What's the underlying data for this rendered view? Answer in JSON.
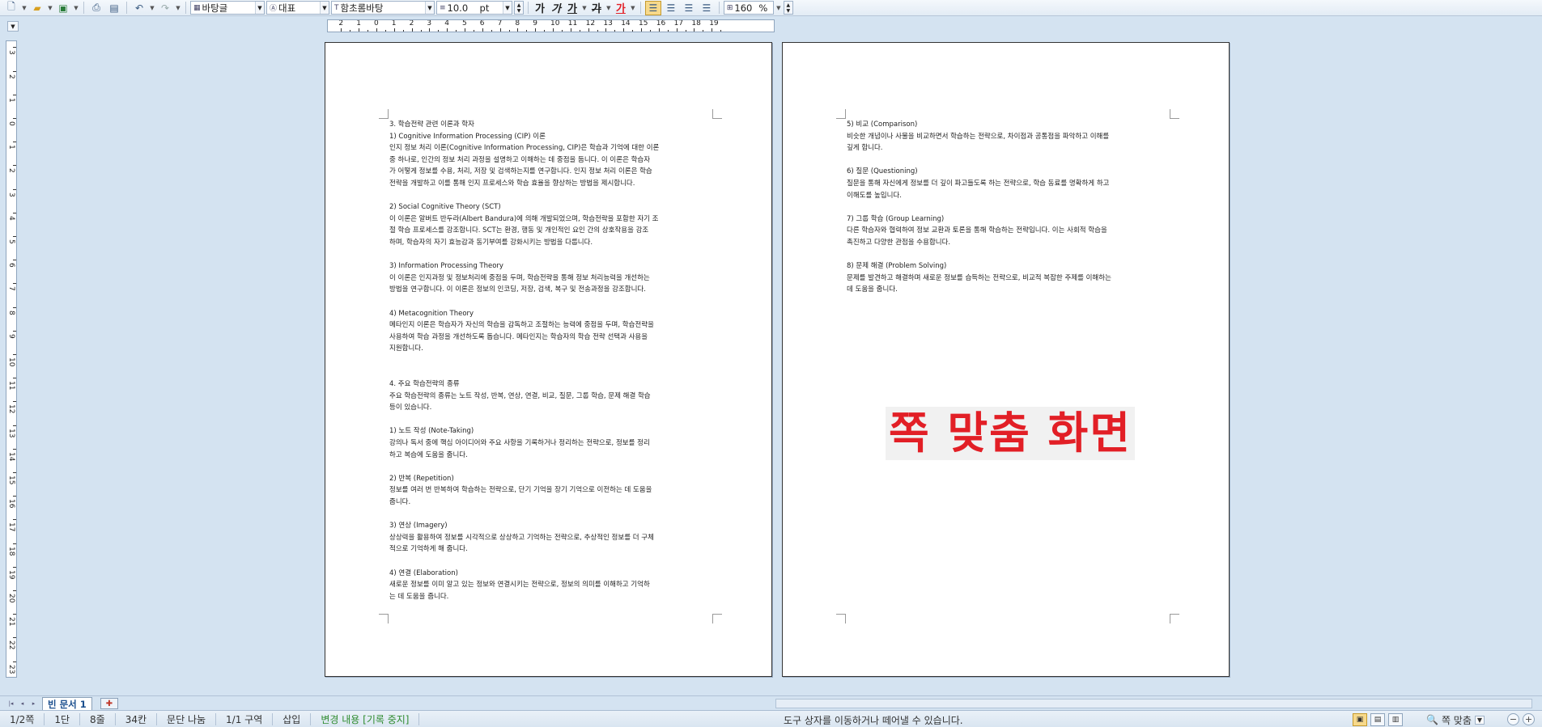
{
  "toolbar": {
    "style_name": "바탕글",
    "lang": "대표",
    "font_name": "함초롬바탕",
    "font_size": "10.0",
    "font_unit": "pt",
    "bold_label": "가",
    "italic_label": "가",
    "underline_label": "가",
    "strike_label": "가",
    "color_label": "가",
    "zoom_value": "160",
    "zoom_unit": "%"
  },
  "page1": {
    "lines": [
      "3. 학습전략 관련 이론과 학자",
      "1) Cognitive Information Processing (CIP) 이론",
      "인지 정보 처리 이론(Cognitive Information Processing, CIP)은 학습과 기억에 대한 이론",
      "중 하나로, 인간의 정보 처리 과정을 설명하고 이해하는 데 중점을 둡니다. 이 이론은 학습자",
      "가 어떻게 정보를 수용, 처리, 저장 및 검색하는지를 연구합니다. 인지 정보 처리 이론은 학습",
      "전략을 개발하고 이를 통해 인지 프로세스와 학습 효율을 향상하는 방법을 제시합니다.",
      "",
      "2) Social Cognitive Theory (SCT)",
      "이 이론은 알버트 반두라(Albert Bandura)에 의해 개발되었으며, 학습전략을 포함한 자기 조",
      "절 학습 프로세스를 강조합니다. SCT는 환경, 행동 및 개인적인 요인 간의 상호작용을 강조",
      "하며, 학습자의 자기 효능감과 동기부여를 강화시키는 방법을 다룹니다.",
      "",
      "3) Information Processing Theory",
      "이 이론은 인지과정 및 정보처리에 중점을 두며, 학습전략을 통해 정보 처리능력을 개선하는",
      "방법을 연구합니다. 이 이론은 정보의 인코딩, 저장, 검색, 복구 및 전송과정을 강조합니다.",
      "",
      "4) Metacognition Theory",
      "메타인지 이론은 학습자가 자신의 학습을 감독하고 조절하는 능력에 중점을 두며, 학습전략을",
      "사용하여 학습 과정을 개선하도록 돕습니다. 메타인지는 학습자의 학습 전략 선택과 사용을",
      "지원합니다.",
      "",
      "",
      "4. 주요 학습전략의 종류",
      "주요 학습전략의 종류는 노트 작성, 반복, 연상, 연결, 비교, 질문, 그룹 학습, 문제 해결 학습",
      "등이 있습니다.",
      "",
      "1) 노트 작성 (Note-Taking)",
      "강의나 독서 중에 핵심 아이디어와 주요 사항을 기록하거나 정리하는 전략으로, 정보를 정리",
      "하고 복습에 도움을 줍니다.",
      "",
      "2) 반복 (Repetition)",
      "정보를 여러 번 반복하여 학습하는 전략으로, 단기 기억을 장기 기억으로 이전하는 데 도움을",
      "줍니다.",
      "",
      "3) 연상 (Imagery)",
      "상상력을 활용하여 정보를 시각적으로 상상하고 기억하는 전략으로, 추상적인 정보를 더 구체",
      "적으로 기억하게 해 줍니다.",
      "",
      "4) 연결 (Elaboration)",
      "새로운 정보를 이미 알고 있는 정보와 연결시키는 전략으로, 정보의 의미를 이해하고 기억하",
      "는 데 도움을 줍니다."
    ]
  },
  "page2": {
    "lines": [
      "5) 비교 (Comparison)",
      "비슷한 개념이나 사물을 비교하면서 학습하는 전략으로, 차이점과 공통점을 파악하고 이해를",
      "깊게 합니다.",
      "",
      "6) 질문 (Questioning)",
      "질문을 통해 자신에게 정보를 더 깊이 파고들도록 하는 전략으로, 학습 동료를 명확하게 하고",
      "이해도를 높입니다.",
      "",
      "7) 그룹 학습 (Group Learning)",
      "다른 학습자와 협력하여 정보 교환과 토론을 통해 학습하는 전략입니다. 이는 사회적 학습을",
      "촉진하고 다양한 관점을 수용합니다.",
      "",
      "8) 문제 해결 (Problem Solving)",
      "문제를 발견하고 해결하며 새로운 정보를 습득하는 전략으로, 비교적 복잡한 주제를 이해하는",
      "데 도움을 줍니다."
    ],
    "fit_label": "쪽 맞춤 화면"
  },
  "tabs": {
    "doc_tab": "빈 문서 1"
  },
  "status": {
    "page": "1/2쪽",
    "column": "1단",
    "line": "8줄",
    "col": "34칸",
    "break": "문단 나눔",
    "section": "1/1 구역",
    "mode": "삽입",
    "track": "변경 내용 [기록 중지]",
    "message": "도구 상자를 이동하거나 떼어낼 수 있습니다.",
    "zoom_fit": "쪽 맞춤"
  },
  "colors": {
    "accent": "#e21f26",
    "track_green": "#2e8b2e",
    "tab_blue": "#1b4f8e"
  }
}
